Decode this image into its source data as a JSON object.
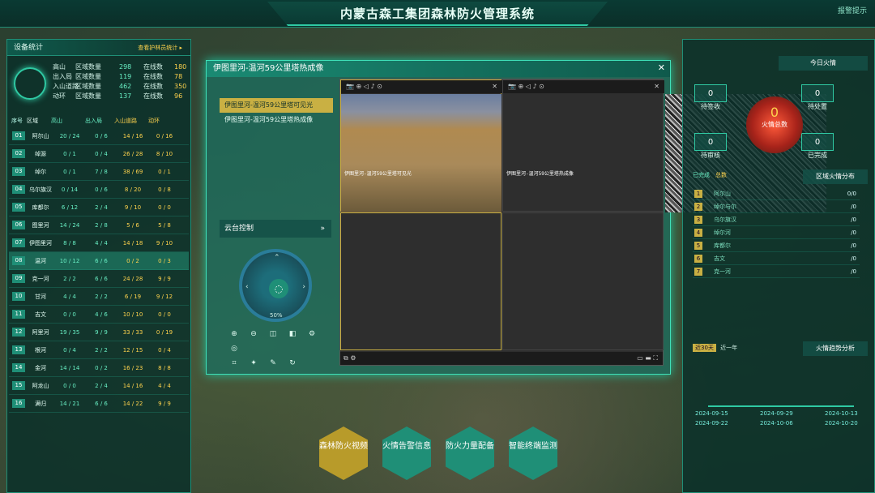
{
  "app": {
    "title": "内蒙古森工集团森林防火管理系统",
    "logout": "报警提示"
  },
  "left": {
    "header": "设备统计",
    "link": "查看护林员统计 ▸",
    "stats": [
      {
        "label": "高山",
        "k1": "区域数量",
        "v1": "298",
        "k2": "在线数",
        "v2": "180"
      },
      {
        "label": "出入局",
        "k1": "区域数量",
        "v1": "119",
        "k2": "在线数",
        "v2": "78"
      },
      {
        "label": "入山道路",
        "k1": "区域数量",
        "v1": "462",
        "k2": "在线数",
        "v2": "350"
      },
      {
        "label": "动环",
        "k1": "区域数量",
        "v1": "137",
        "k2": "在线数",
        "v2": "96"
      }
    ],
    "columns": [
      "序号",
      "区域",
      "高山",
      "出入局",
      "入山道路",
      "动环"
    ],
    "rows": [
      [
        "01",
        "阿尔山",
        "20 / 24",
        "0 / 6",
        "14 / 16",
        "0 / 16"
      ],
      [
        "02",
        "绰源",
        "0 / 1",
        "0 / 4",
        "26 / 28",
        "8 / 10"
      ],
      [
        "03",
        "绰尔",
        "0 / 1",
        "7 / 8",
        "38 / 69",
        "0 / 1"
      ],
      [
        "04",
        "乌尔旗汉",
        "0 / 14",
        "0 / 6",
        "8 / 20",
        "0 / 8"
      ],
      [
        "05",
        "库都尔",
        "6 / 12",
        "2 / 4",
        "9 / 10",
        "0 / 0"
      ],
      [
        "06",
        "图里河",
        "14 / 24",
        "2 / 8",
        "5 / 6",
        "5 / 8"
      ],
      [
        "07",
        "伊图里河",
        "8 / 8",
        "4 / 4",
        "14 / 18",
        "9 / 10"
      ],
      [
        "08",
        "温河",
        "10 / 12",
        "6 / 6",
        "0 / 2",
        "0 / 3"
      ],
      [
        "09",
        "克一河",
        "2 / 2",
        "6 / 6",
        "24 / 28",
        "9 / 9"
      ],
      [
        "10",
        "甘河",
        "4 / 4",
        "2 / 2",
        "6 / 19",
        "9 / 12"
      ],
      [
        "11",
        "吉文",
        "0 / 0",
        "4 / 6",
        "10 / 10",
        "0 / 0"
      ],
      [
        "12",
        "阿里河",
        "19 / 35",
        "9 / 9",
        "33 / 33",
        "0 / 19"
      ],
      [
        "13",
        "根河",
        "0 / 4",
        "2 / 2",
        "12 / 15",
        "0 / 4"
      ],
      [
        "14",
        "金河",
        "14 / 14",
        "0 / 2",
        "16 / 23",
        "8 / 8"
      ],
      [
        "15",
        "阿龙山",
        "0 / 0",
        "2 / 4",
        "14 / 16",
        "4 / 4"
      ],
      [
        "16",
        "满归",
        "14 / 21",
        "6 / 6",
        "14 / 22",
        "9 / 9"
      ]
    ]
  },
  "dialog": {
    "title": "伊图里河-温河59公里塔热成像",
    "tree": [
      "伊图里河-温河59公里塔可见光",
      "伊图里河-温河59公里塔热成像"
    ],
    "ptz_title": "云台控制",
    "ptz_zoom": "50%",
    "video1": {
      "ov": "伊图里河-温河59公里塔可见光"
    },
    "video2": {
      "ov": "伊图里河-温河59公里塔热成像"
    }
  },
  "right": {
    "header": "今日火情",
    "counters": [
      {
        "label": "待签收",
        "value": "0"
      },
      {
        "label": "待处置",
        "value": "0"
      },
      {
        "label": "待审核",
        "value": "0"
      },
      {
        "label": "已完成",
        "value": "0"
      }
    ],
    "total_label": "火情总数",
    "total": "0",
    "dist_title": "区域火情分布",
    "legend": [
      "已完成",
      "总数"
    ],
    "fire_list": [
      [
        "1",
        "阿尔山",
        "0/0"
      ],
      [
        "2",
        "绰尔与尔",
        "/0"
      ],
      [
        "3",
        "乌尔旗汉",
        "/0"
      ],
      [
        "4",
        "绰尔河",
        "/0"
      ],
      [
        "5",
        "库都尔",
        "/0"
      ],
      [
        "6",
        "吉文",
        "/0"
      ],
      [
        "7",
        "克一河",
        "/0"
      ]
    ],
    "trend_title": "火情趋势分析",
    "trend_tabs": [
      "近30天",
      "近一年"
    ],
    "trend_dates_top": [
      "2024-09-15",
      "2024-09-29",
      "2024-10-13"
    ],
    "trend_dates_bot": [
      "2024-09-22",
      "2024-10-06",
      "2024-10-20"
    ]
  },
  "nav": [
    {
      "label": "森林防火视频",
      "active": true
    },
    {
      "label": "火情告警信息"
    },
    {
      "label": "防火力量配备"
    },
    {
      "label": "智能终端监测"
    }
  ]
}
